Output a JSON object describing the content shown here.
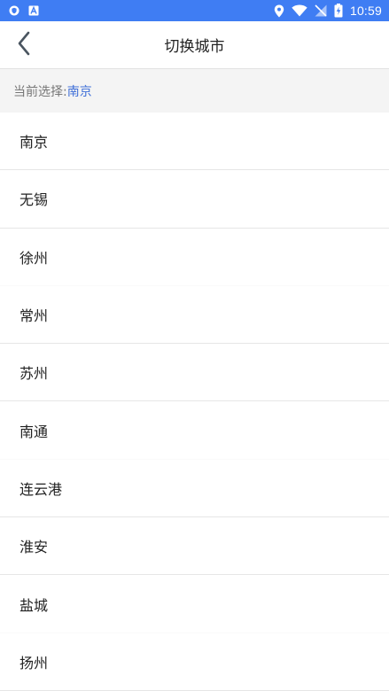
{
  "status_bar": {
    "time": "10:59",
    "icons": [
      "shield-icon",
      "a-icon",
      "location-icon",
      "wifi-icon",
      "no-sim-icon",
      "battery-charging-icon"
    ],
    "color": "#3f7df3"
  },
  "header": {
    "title": "切换城市",
    "back_icon": "chevron-left-icon"
  },
  "current": {
    "label": "当前选择:",
    "value": "南京",
    "value_color": "#3f6fd8"
  },
  "cities": [
    {
      "label": "南京"
    },
    {
      "label": "无锡"
    },
    {
      "label": "徐州"
    },
    {
      "label": "常州"
    },
    {
      "label": "苏州"
    },
    {
      "label": "南通"
    },
    {
      "label": "连云港"
    },
    {
      "label": "淮安"
    },
    {
      "label": "盐城"
    },
    {
      "label": "扬州"
    }
  ]
}
